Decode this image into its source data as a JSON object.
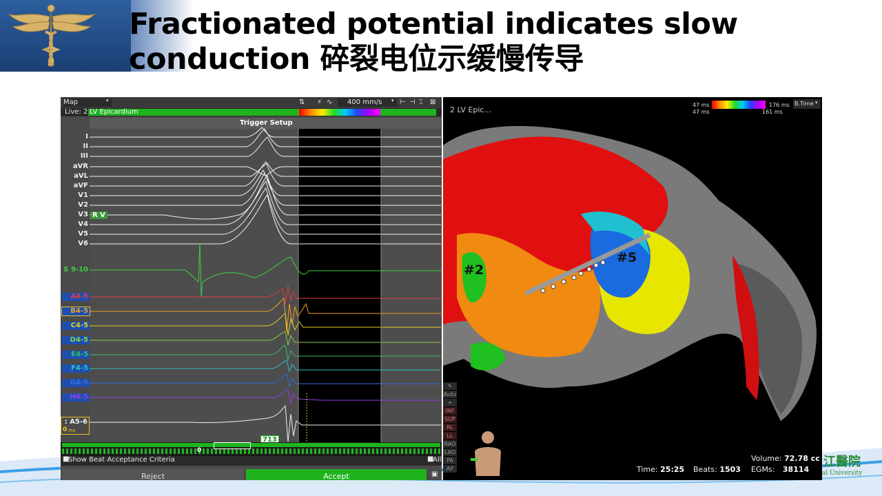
{
  "slide": {
    "title_line1": "Fractionated potential indicates slow",
    "title_line2": "conduction 碎裂电位示缓慢传导",
    "watermark_cn": "江醫院",
    "watermark_en": "ical University"
  },
  "ep_panel": {
    "view_select": "Map",
    "live_label": "Live: 2",
    "map_name": "LV Epicardium",
    "sweep_speed": "400 mm/s",
    "trigger_header": "Trigger Setup",
    "rv_badge": "R V",
    "ecg_leads": [
      "I",
      "II",
      "III",
      "aVR",
      "aVL",
      "aVF",
      "V1",
      "V2",
      "V3",
      "V4",
      "V5",
      "V6"
    ],
    "ref_channel": "S 9-10",
    "bipoles": [
      {
        "label": "A4-5",
        "color": "#e23c3c"
      },
      {
        "label": "B4-5",
        "color": "#f0a020"
      },
      {
        "label": "C4-5",
        "color": "#e0d020"
      },
      {
        "label": "D4-5",
        "color": "#8ad040"
      },
      {
        "label": "E4-5",
        "color": "#30c060"
      },
      {
        "label": "F4-5",
        "color": "#30c0c0"
      },
      {
        "label": "G4-5",
        "color": "#3070e0"
      },
      {
        "label": "H4-5",
        "color": "#9040e0"
      }
    ],
    "selected_channel": ": A5-6",
    "zero_ms": "0",
    "ms_unit": "ms",
    "beat_counter": "713",
    "timeline_zero": "0",
    "show_beat_label": "Show Beat Acceptance Criteria",
    "all_label": "All",
    "reject_label": "Reject",
    "accept_label": "Accept"
  },
  "map_panel": {
    "map_title": "2 LV Epic...",
    "lat_min_top": "47 ms",
    "lat_min_bottom": "47 ms",
    "lat_max_top": "176 ms",
    "lat_max_bottom": "161 ms",
    "map_type": "B.Time",
    "marker_2": "#2",
    "marker_5": "#5",
    "side_buttons": [
      "Auto",
      "+",
      "INF",
      "SUP",
      "RL",
      "LL",
      "RAO",
      "LAO",
      "PA",
      "AP"
    ],
    "volume_label": "Volume:",
    "volume_value": "72.78 cc",
    "time_label": "Time:",
    "time_value": "25:25",
    "beats_label": "Beats:",
    "beats_value": "1503",
    "egms_label": "EGMs:",
    "egms_value": "38114"
  },
  "colors": {
    "accept_green": "#1fb41f",
    "chip_blue": "#1e4fb0",
    "map_red": "#e01010",
    "map_yellow": "#e6e600",
    "map_blue": "#1a6ae0"
  }
}
